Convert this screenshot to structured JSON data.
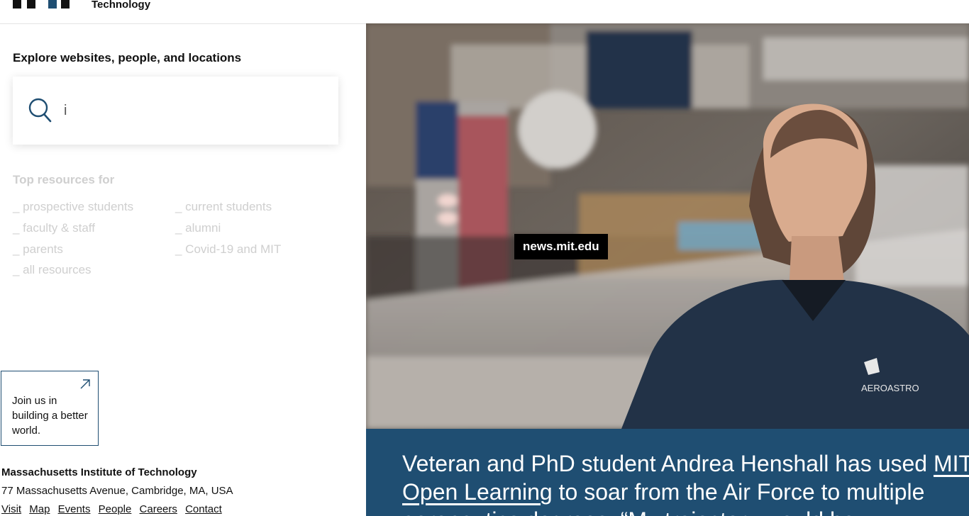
{
  "header": {
    "logo_text": "Technology",
    "logo_icon": "mit-logo-icon"
  },
  "search": {
    "title": "Explore websites, people, and locations",
    "value": "i",
    "placeholder": "",
    "icon": "search-icon"
  },
  "resources": {
    "title": "Top resources for",
    "items": [
      "_ prospective students",
      "_ current students",
      "_ faculty & staff",
      "_ alumni",
      "_ parents",
      "_ Covid-19 and MIT",
      "_ all resources"
    ]
  },
  "cta": {
    "text": "Join us in building a better world.",
    "icon": "arrow-up-right-icon",
    "border_color": "#1f4e72"
  },
  "footer": {
    "name": "Massachusetts Institute of Technology",
    "address": "77 Massachusetts Avenue, Cambridge, MA, USA",
    "links": [
      "Visit",
      "Map",
      "Events",
      "People",
      "Careers",
      "Contact"
    ]
  },
  "hero": {
    "badge": "news.mit.edu",
    "caption_line1_prefix": "Veteran and PhD student Andrea Henshall has used ",
    "caption_link_part1": "MIT",
    "caption_link_part2": "Open Learning",
    "caption_line2_suffix": " to soar from the Air Force to multiple",
    "caption_line3": "aeronautics degrees. “My trajectory would be … ",
    "jacket_logo": "AEROASTRO",
    "caption_bg": "#1f4e72"
  }
}
